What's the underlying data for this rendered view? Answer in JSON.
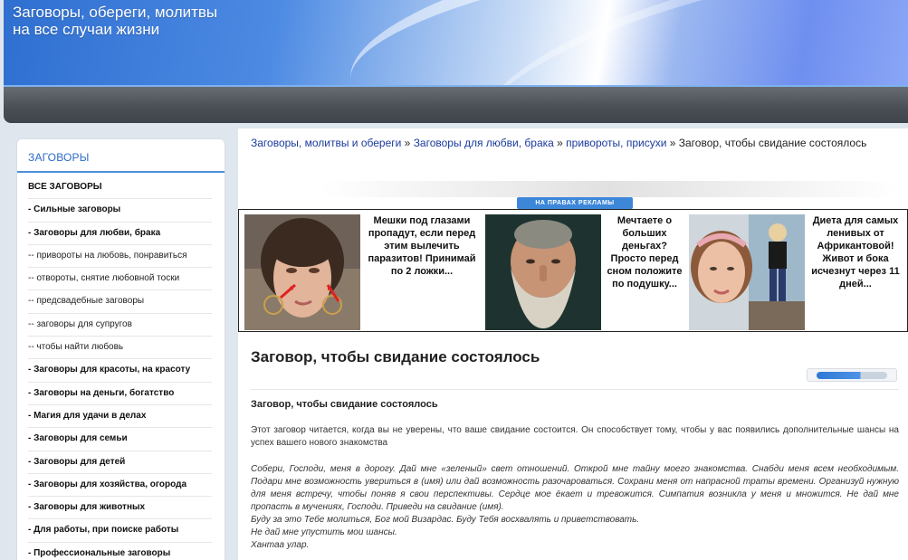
{
  "header": {
    "site_title": "Заговоры, обереги, молитвы\nна все случаи жизни"
  },
  "sidebar": {
    "title": "ЗАГОВОРЫ",
    "items": [
      {
        "label": "ВСЕ ЗАГОВОРЫ",
        "bold": true
      },
      {
        "label": "- Сильные заговоры",
        "bold": true
      },
      {
        "label": "- Заговоры для любви, брака",
        "bold": true
      },
      {
        "label": "-- привороты на любовь, понравиться",
        "bold": false
      },
      {
        "label": "-- отвороты, снятие любовной тоски",
        "bold": false
      },
      {
        "label": "-- предсвадебные заговоры",
        "bold": false
      },
      {
        "label": "-- заговоры для супругов",
        "bold": false
      },
      {
        "label": "-- чтобы найти любовь",
        "bold": false
      },
      {
        "label": "- Заговоры для красоты, на красоту",
        "bold": true
      },
      {
        "label": "- Заговоры на деньги, богатство",
        "bold": true
      },
      {
        "label": "- Магия для удачи в делах",
        "bold": true
      },
      {
        "label": "- Заговоры для семьи",
        "bold": true
      },
      {
        "label": "- Заговоры для детей",
        "bold": true
      },
      {
        "label": "- Заговоры для хозяйства, огорода",
        "bold": true
      },
      {
        "label": "- Заговоры для животных",
        "bold": true
      },
      {
        "label": "- Для работы, при поиске работы",
        "bold": true
      },
      {
        "label": "- Профессиональные заговоры",
        "bold": true
      }
    ]
  },
  "breadcrumb": {
    "link1": "Заговоры, молитвы и обереги",
    "link2": "Заговоры для любви, брака",
    "link3": "привороты, присухи",
    "separator": " » ",
    "current": "Заговор, чтобы свидание состоялось"
  },
  "ads": {
    "label": "НА ПРАВАХ РЕКЛАМЫ",
    "items": [
      {
        "text": "Мешки под глазами пропадут, если перед этим вылечить паразитов! Принимай по 2 ложки..."
      },
      {
        "text": "Мечтаете о больших деньгах? Просто перед сном положите по подушку..."
      },
      {
        "text": "Диета для самых ленивых от Африкантовой! Живот и бока исчезнут через 11 дней..."
      }
    ]
  },
  "article": {
    "title": "Заговор, чтобы свидание состоялось",
    "rating": 0.62,
    "subtitle": "Заговор, чтобы свидание состоялось",
    "intro": "Этот заговор читается, когда вы не уверены, что ваше свидание состоится. Он способствует тому, чтобы у вас появились дополнительные шансы на успех вашего нового знакомства",
    "prayer_lines": [
      "Собери, Господи, меня в дорогу. Дай мне «зеленый» свет отношений. Открой мне тайну моего знакомства. Снабди меня всем необходимым. Подари мне возможность увериться в (имя) или дай возможность разочароваться. Сохрани меня от напрасной траты времени. Организуй нужную для меня встречу, чтобы поняв я свои перспективы. Сердце мое ёкает и тревожится. Симпатия возникла у меня и множится. Не дай мне пропасть в мучениях, Господи. Приведи на свидание (имя).",
      "Буду за это Тебе молиться, Бог мой Визардас. Буду Тебя восхвалять и приветствовать.",
      "Не дай мне упустить мои шансы.",
      "Хантаа улар."
    ]
  }
}
